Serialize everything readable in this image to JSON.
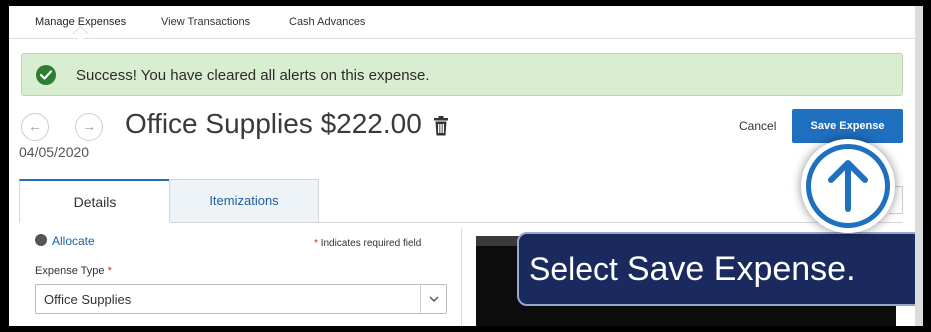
{
  "nav": {
    "tabs": [
      {
        "label": "Manage Expenses",
        "active": true
      },
      {
        "label": "View Transactions"
      },
      {
        "label": "Cash Advances"
      }
    ]
  },
  "banner": {
    "message": "Success! You have cleared all alerts on this expense.",
    "icon": "check-circle-icon",
    "color": "#d9edd0"
  },
  "expense": {
    "prev_icon": "←",
    "next_icon": "→",
    "title": "Office Supplies $222.00",
    "date": "04/05/2020"
  },
  "actions": {
    "cancel_label": "Cancel",
    "save_label": "Save Expense"
  },
  "tabs": {
    "details_label": "Details",
    "itemizations_label": "Itemizations"
  },
  "form": {
    "allocate_label": "Allocate",
    "required_note": "Indicates required field",
    "required_star": "*",
    "expense_type_label": "Expense Type",
    "expense_type_value": "Office Supplies"
  },
  "callout": {
    "text_a": "Select ",
    "text_b": "Save Expense."
  },
  "colors": {
    "accent": "#1f6fbf",
    "callout_bg": "#1b2a5e",
    "success_icon": "#2f7d32"
  }
}
